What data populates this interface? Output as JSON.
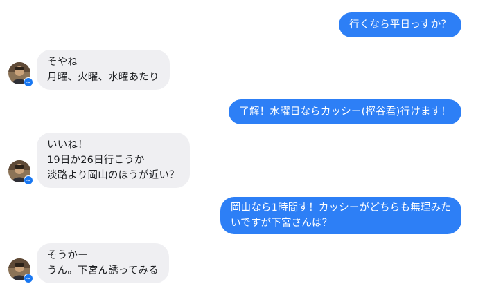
{
  "messages": [
    {
      "side": "out",
      "text": "行くなら平日っすか？"
    },
    {
      "side": "in",
      "text": "そやね\n月曜、火曜、水曜あたり"
    },
    {
      "side": "out",
      "text": "了解！水曜日ならカッシー(樫谷君)行けます！"
    },
    {
      "side": "in",
      "text": "いいね！\n19日か26日行こうか\n淡路より岡山のほうが近い？"
    },
    {
      "side": "out",
      "text": "岡山なら1時間す！カッシーがどちらも無理みた\nいですが下宮さんは？"
    },
    {
      "side": "in",
      "text": "そうかー\nうん。下宮ん誘ってみる"
    }
  ],
  "avatar": {
    "icon": "user-photo-icon",
    "badge_icon": "messenger-badge-icon"
  },
  "colors": {
    "outgoing": "#2d7ff6",
    "incoming": "#efeff2"
  }
}
